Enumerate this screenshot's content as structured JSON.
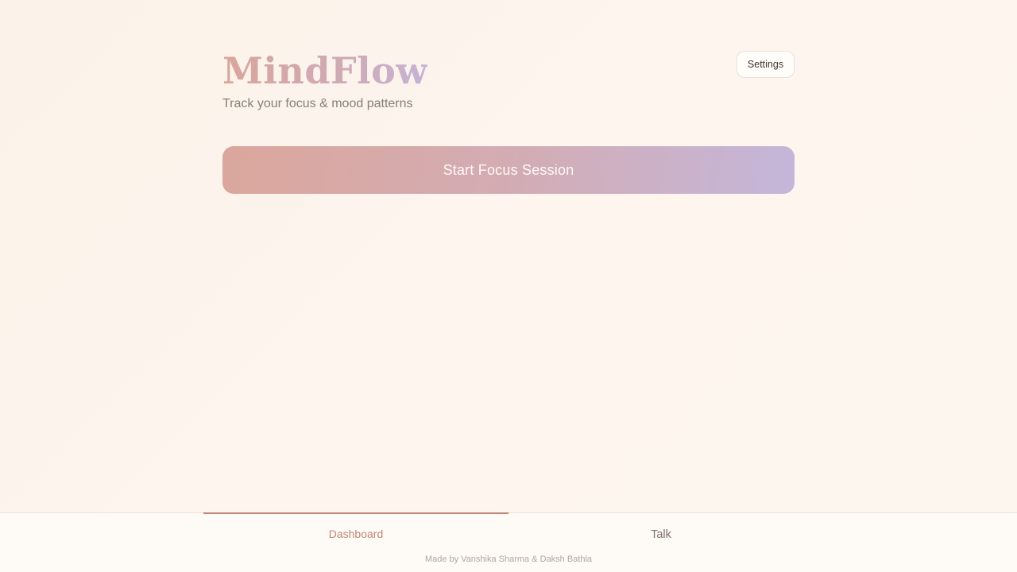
{
  "header": {
    "title": "MindFlow",
    "subtitle": "Track your focus & mood patterns",
    "settings_label": "Settings"
  },
  "main": {
    "start_button_label": "Start Focus Session"
  },
  "nav": {
    "tabs": [
      {
        "label": "Dashboard",
        "active": true
      },
      {
        "label": "Talk",
        "active": false
      }
    ]
  },
  "footer": {
    "credit": "Made by Vanshika Sharma & Daksh Bathla"
  },
  "colors": {
    "accent": "#c08779",
    "gradient_start": "#dba79c",
    "gradient_end": "#c4b6da"
  }
}
